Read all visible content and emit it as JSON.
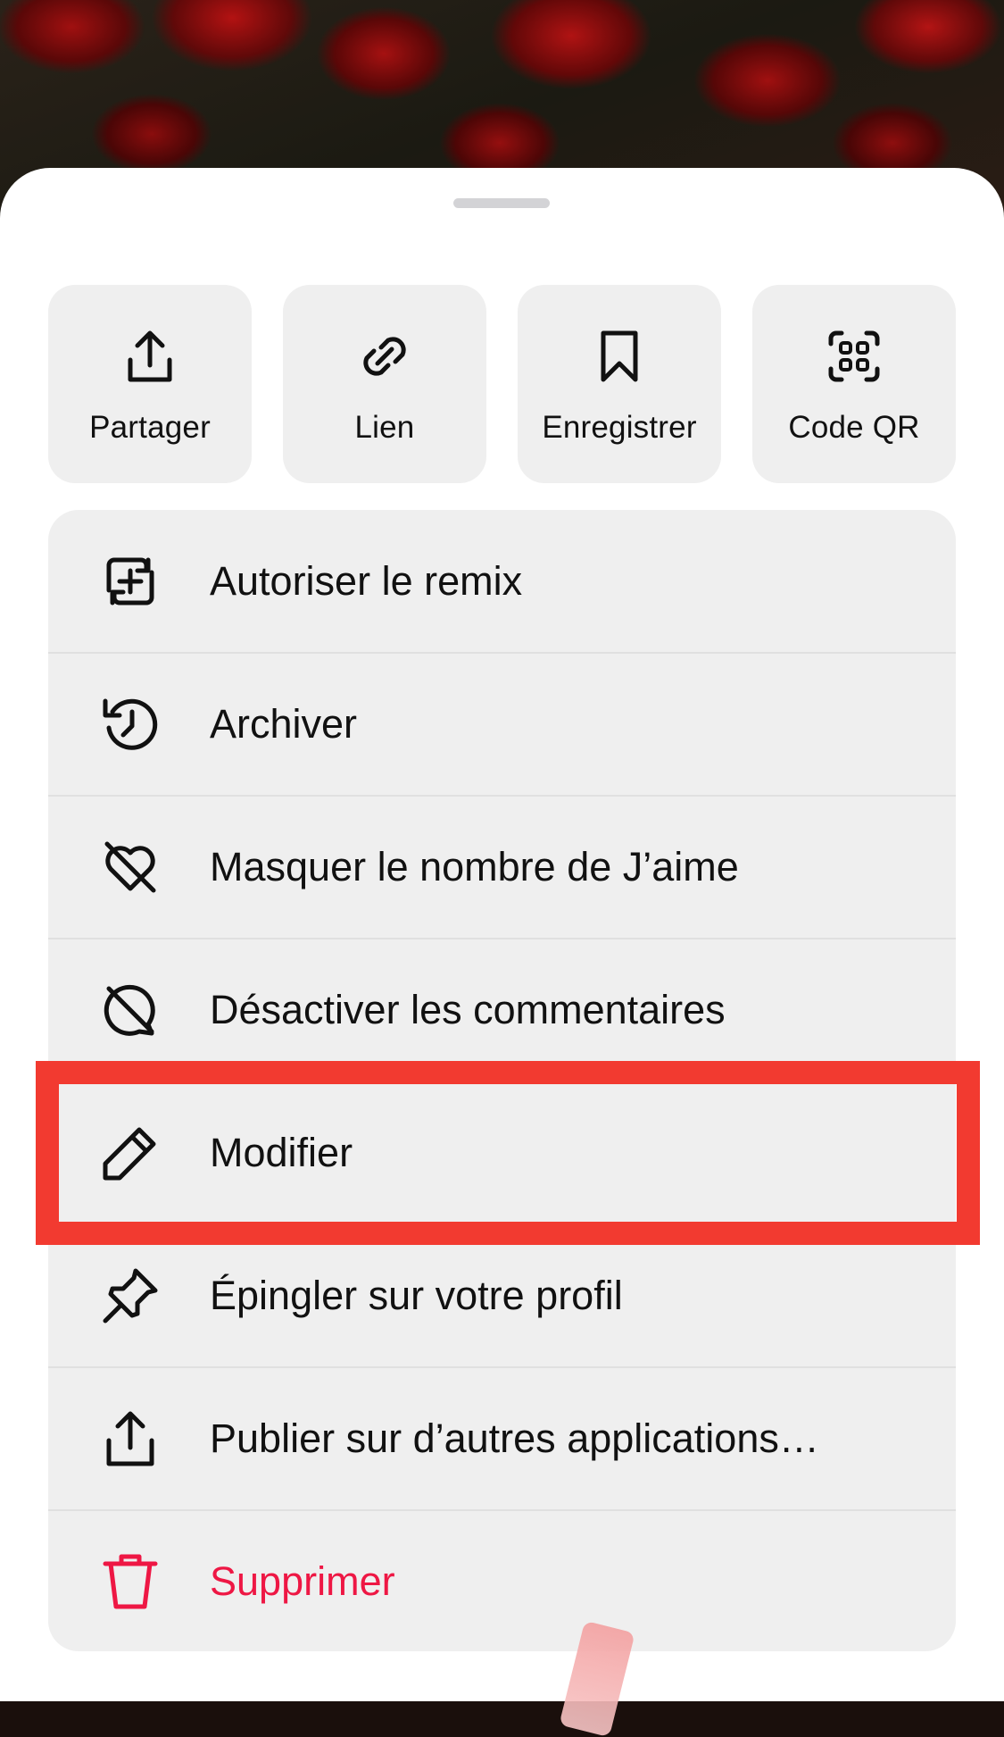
{
  "quick_actions": [
    {
      "label": "Partager",
      "icon": "share-icon"
    },
    {
      "label": "Lien",
      "icon": "link-icon"
    },
    {
      "label": "Enregistrer",
      "icon": "bookmark-icon"
    },
    {
      "label": "Code QR",
      "icon": "qr-code-icon"
    }
  ],
  "menu": {
    "items": [
      {
        "label": "Autoriser le remix",
        "icon": "remix-icon"
      },
      {
        "label": "Archiver",
        "icon": "archive-history-icon"
      },
      {
        "label": "Masquer le nombre de J’aime",
        "icon": "heart-off-icon"
      },
      {
        "label": "Désactiver les commentaires",
        "icon": "comments-off-icon"
      },
      {
        "label": "Modifier",
        "icon": "pencil-icon"
      },
      {
        "label": "Épingler sur votre profil",
        "icon": "pin-icon"
      },
      {
        "label": "Publier sur d’autres applications…",
        "icon": "share-icon"
      },
      {
        "label": "Supprimer",
        "icon": "trash-icon"
      }
    ]
  },
  "colors": {
    "danger": "#ee1744",
    "highlight_border": "#f23a30",
    "tile_bg": "#efefef"
  }
}
